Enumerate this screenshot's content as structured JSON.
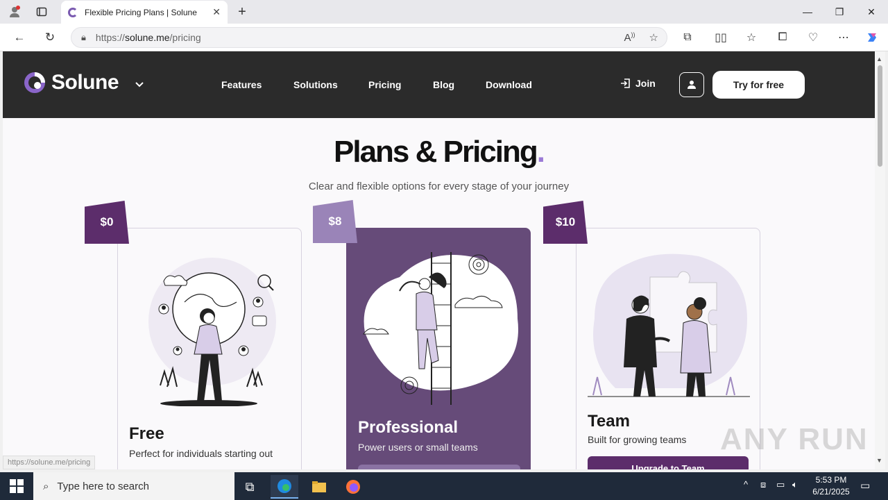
{
  "browser": {
    "tab_title": "Flexible Pricing Plans | Solune",
    "url_scheme": "https://",
    "url_host": "solune.me",
    "url_path": "/pricing",
    "status_url": "https://solune.me/pricing"
  },
  "site": {
    "logo_name": "Solune",
    "nav": [
      "Features",
      "Solutions",
      "Pricing",
      "Blog",
      "Download"
    ],
    "join_label": "Join",
    "try_label": "Try for free"
  },
  "hero": {
    "title": "Plans & Pricing",
    "title_dot": ".",
    "subtitle": "Clear and flexible options for every stage of your journey"
  },
  "plans": [
    {
      "price": "$0",
      "name": "Free",
      "desc": "Perfect for individuals starting out",
      "tag_color": "#5c2d6b"
    },
    {
      "price": "$8",
      "name": "Professional",
      "desc": "Power users or small teams",
      "tag_color": "#9a84b8"
    },
    {
      "price": "$10",
      "name": "Team",
      "desc": "Built for growing teams",
      "button": "Upgrade to Team",
      "tag_color": "#5c2d6b"
    }
  ],
  "taskbar": {
    "search_placeholder": "Type here to search",
    "time": "5:53 PM",
    "date": "6/21/2025"
  },
  "watermark": "ANY RUN",
  "colors": {
    "header_bg": "#2b2b2b",
    "pro_card": "#664b79",
    "accent": "#9b7ad6"
  }
}
